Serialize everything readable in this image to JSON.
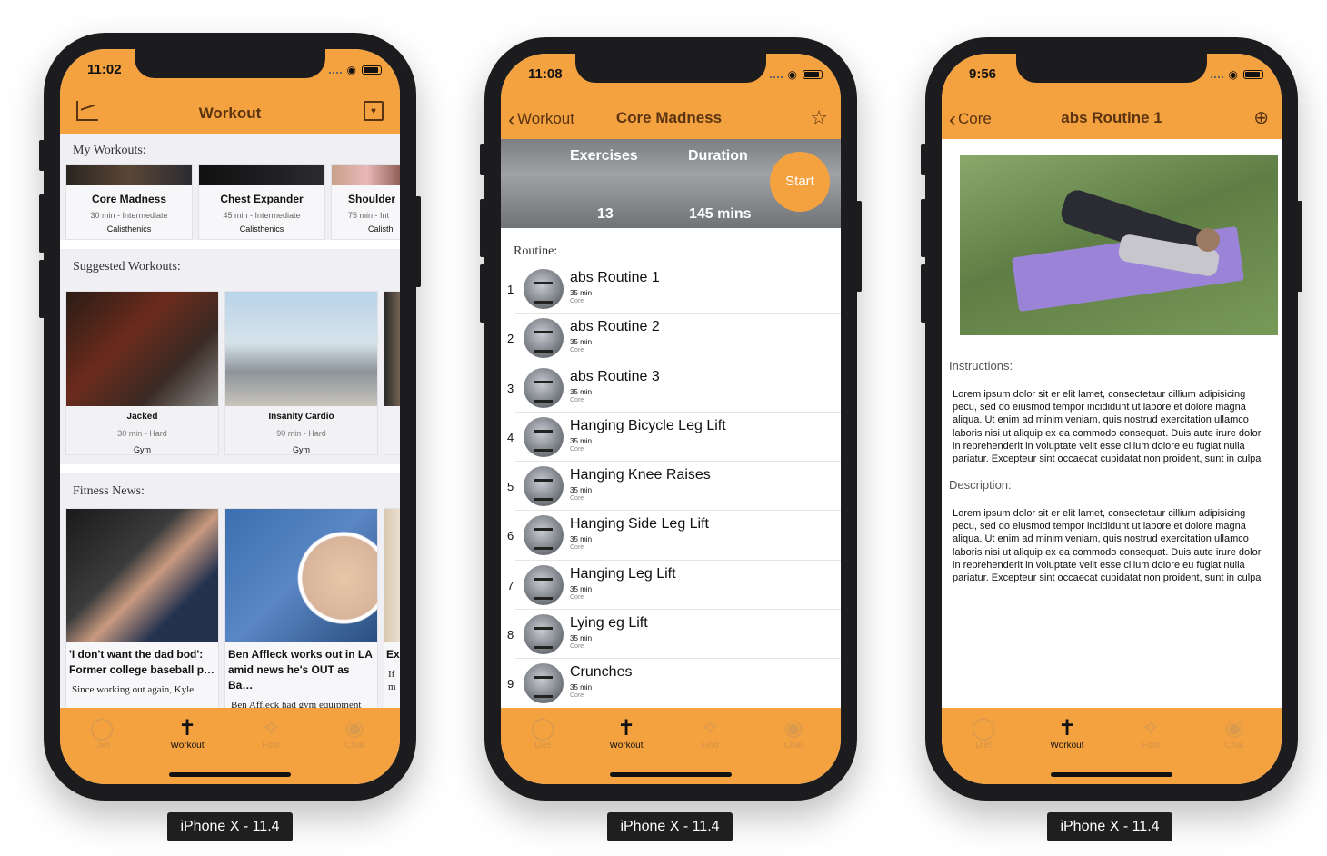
{
  "colors": {
    "accent": "#f4a13f",
    "nav_text": "#5a3410",
    "device_frame": "#1c1c1e"
  },
  "device_label": "iPhone X - 11.4",
  "tabs": [
    {
      "label": "Diet",
      "icon": "apple-icon"
    },
    {
      "label": "Workout",
      "icon": "exercise-figure-icon"
    },
    {
      "label": "Find",
      "icon": "people-search-icon"
    },
    {
      "label": "Chat",
      "icon": "chat-people-icon"
    }
  ],
  "phone1": {
    "time": "11:02",
    "title": "Workout",
    "my_workouts_heading": "My Workouts:",
    "my_workouts": [
      {
        "name": "Core Madness",
        "meta": "30 min - Intermediate",
        "category": "Calisthenics"
      },
      {
        "name": "Chest Expander",
        "meta": "45 min - Intermediate",
        "category": "Calisthenics"
      },
      {
        "name": "Shoulder",
        "meta": "75 min - Int",
        "category": "Calisth"
      }
    ],
    "suggested_heading": "Suggested Workouts:",
    "suggested": [
      {
        "name": "Jacked",
        "meta": "30 min - Hard",
        "category": "Gym"
      },
      {
        "name": "Insanity Cardio",
        "meta": "90 min - Hard",
        "category": "Gym"
      }
    ],
    "news_heading": "Fitness News:",
    "news": [
      {
        "headline": "'I don't want the dad bod': Former college baseball p…",
        "snippet": "Since working out again, Kyle"
      },
      {
        "headline": "Ben Affleck works out in LA amid news he's OUT as Ba…",
        "snippet": "Ben Affleck had gym equipment delivered to his"
      },
      {
        "headline": "Ex",
        "snippet": "If m"
      }
    ]
  },
  "phone2": {
    "time": "11:08",
    "back_label": "Workout",
    "title": "Core Madness",
    "exercises_label": "Exercises",
    "exercises_value": "13",
    "duration_label": "Duration",
    "duration_value": "145 mins",
    "start_label": "Start",
    "routine_heading": "Routine:",
    "routines": [
      {
        "num": "1",
        "name": "abs Routine 1",
        "duration": "35 min",
        "category": "Core"
      },
      {
        "num": "2",
        "name": "abs Routine 2",
        "duration": "35 min",
        "category": "Core"
      },
      {
        "num": "3",
        "name": "abs Routine 3",
        "duration": "35 min",
        "category": "Core"
      },
      {
        "num": "4",
        "name": "Hanging Bicycle Leg Lift",
        "duration": "35 min",
        "category": "Core"
      },
      {
        "num": "5",
        "name": "Hanging Knee Raises",
        "duration": "35 min",
        "category": "Core"
      },
      {
        "num": "6",
        "name": "Hanging Side Leg Lift",
        "duration": "35 min",
        "category": "Core"
      },
      {
        "num": "7",
        "name": "Hanging Leg Lift",
        "duration": "35 min",
        "category": "Core"
      },
      {
        "num": "8",
        "name": "Lying eg Lift",
        "duration": "35 min",
        "category": "Core"
      },
      {
        "num": "9",
        "name": "Crunches",
        "duration": "35 min",
        "category": "Core"
      }
    ]
  },
  "phone3": {
    "time": "9:56",
    "back_label": "Core",
    "title": "abs Routine 1",
    "instructions_heading": "Instructions:",
    "instructions_text": "Lorem ipsum dolor sit er elit lamet, consectetaur cillium adipisicing pecu, sed do eiusmod tempor incididunt ut labore et dolore magna aliqua. Ut enim ad minim veniam, quis nostrud exercitation ullamco laboris nisi ut aliquip ex ea commodo consequat. Duis aute irure dolor in reprehenderit in voluptate velit esse cillum dolore eu fugiat nulla pariatur. Excepteur sint occaecat cupidatat non proident, sunt in culpa",
    "description_heading": "Description:",
    "description_text": "Lorem ipsum dolor sit er elit lamet, consectetaur cillium adipisicing pecu, sed do eiusmod tempor incididunt ut labore et dolore magna aliqua. Ut enim ad minim veniam, quis nostrud exercitation ullamco laboris nisi ut aliquip ex ea commodo consequat. Duis aute irure dolor in reprehenderit in voluptate velit esse cillum dolore eu fugiat nulla pariatur. Excepteur sint occaecat cupidatat non proident, sunt in culpa"
  }
}
